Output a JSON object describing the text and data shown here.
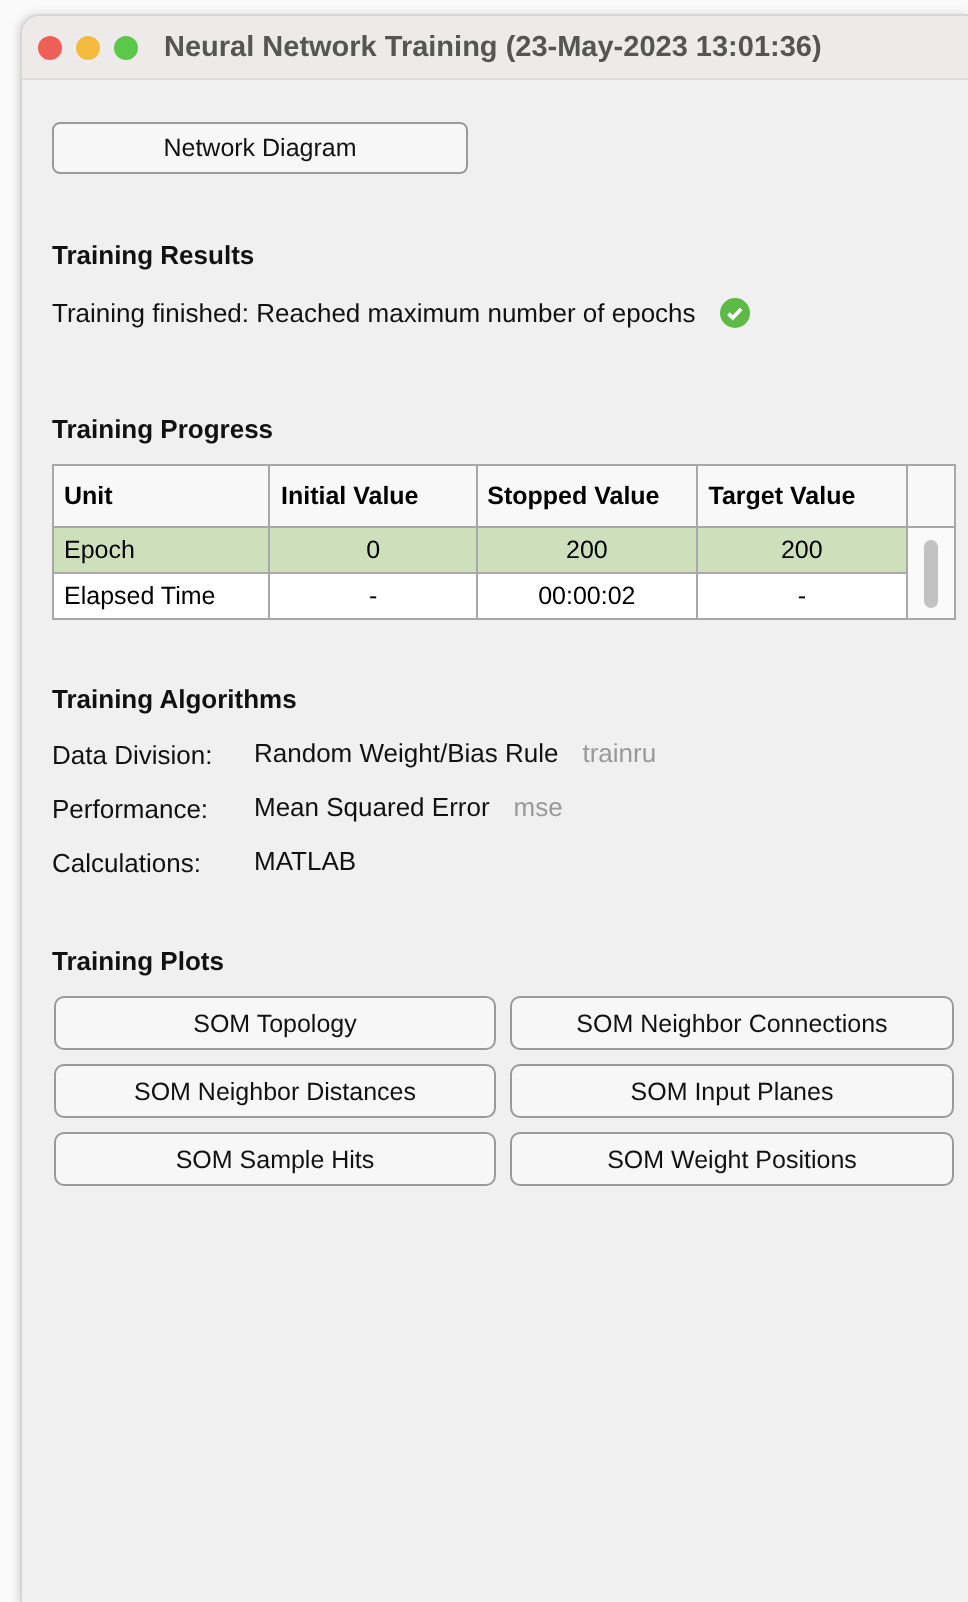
{
  "window": {
    "title": "Neural Network Training (23-May-2023 13:01:36)"
  },
  "network_button": "Network Diagram",
  "results": {
    "heading": "Training Results",
    "message": "Training finished: Reached maximum number of epochs",
    "success": true
  },
  "progress": {
    "heading": "Training Progress",
    "columns": [
      "Unit",
      "Initial Value",
      "Stopped Value",
      "Target Value"
    ],
    "rows": [
      {
        "cells": [
          "Epoch",
          "0",
          "200",
          "200"
        ],
        "selected": true
      },
      {
        "cells": [
          "Elapsed Time",
          "-",
          "00:00:02",
          "-"
        ],
        "selected": false
      }
    ]
  },
  "algorithms": {
    "heading": "Training Algorithms",
    "items": [
      {
        "label": "Data Division:",
        "value": "Random Weight/Bias Rule",
        "code": "trainru"
      },
      {
        "label": "Performance:",
        "value": "Mean Squared Error",
        "code": "mse"
      },
      {
        "label": "Calculations:",
        "value": "MATLAB"
      }
    ]
  },
  "plots": {
    "heading": "Training Plots",
    "buttons": [
      "SOM Topology",
      "SOM Neighbor Connections",
      "SOM Neighbor Distances",
      "SOM Input Planes",
      "SOM Sample Hits",
      "SOM Weight Positions"
    ]
  }
}
